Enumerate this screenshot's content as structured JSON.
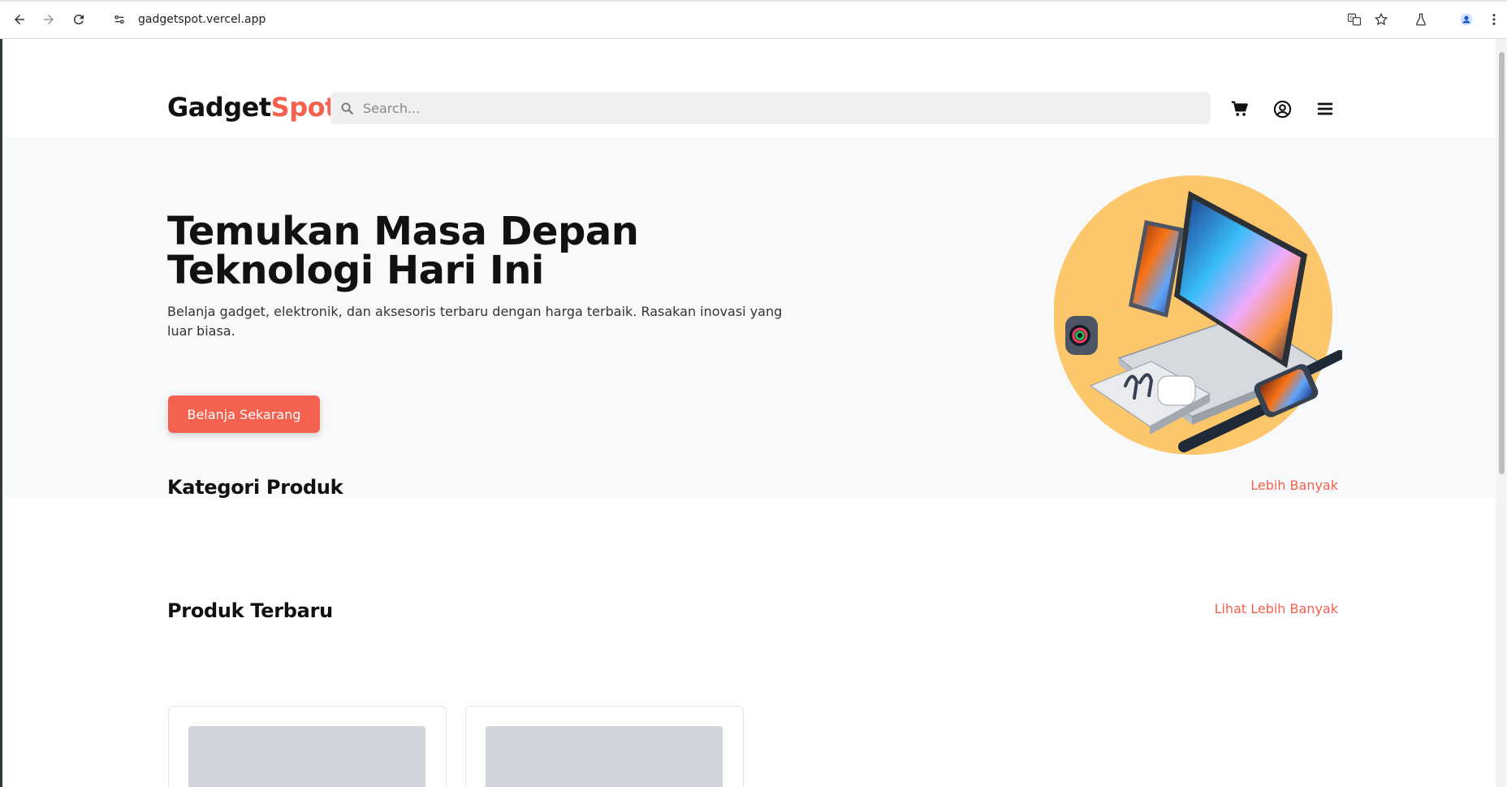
{
  "browser": {
    "url": "gadgetspot.vercel.app"
  },
  "header": {
    "logo_part1": "Gadget",
    "logo_part2": "Spot",
    "search_placeholder": "Search..."
  },
  "hero": {
    "title_line1": "Temukan Masa Depan",
    "title_line2": "Teknologi Hari Ini",
    "subtitle": "Belanja gadget, elektronik, dan aksesoris terbaru dengan harga terbaik. Rasakan inovasi yang luar biasa.",
    "cta_label": "Belanja Sekarang"
  },
  "categories": {
    "title": "Kategori Produk",
    "more_label": "Lebih Banyak"
  },
  "latest_products": {
    "title": "Produk Terbaru",
    "more_label": "Lihat Lebih Banyak"
  },
  "colors": {
    "accent": "#f4614f",
    "hero_bg": "#f8f9fa",
    "hero_circle": "#fcc76a"
  }
}
